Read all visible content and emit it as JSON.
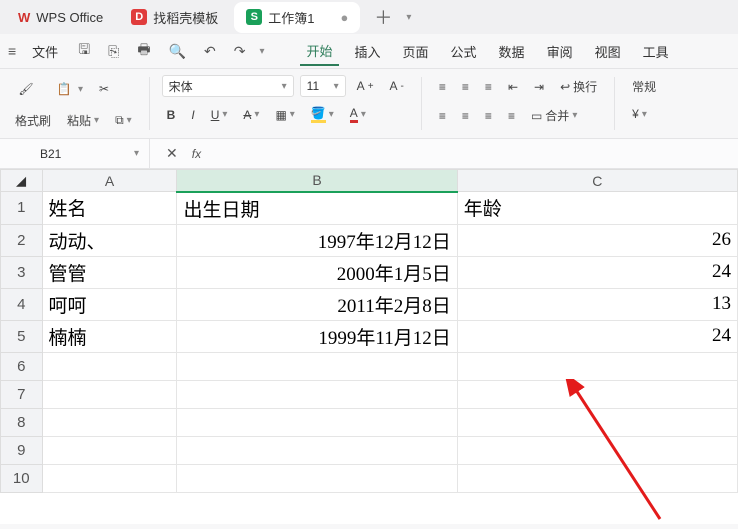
{
  "top_tabs": {
    "office": "WPS Office",
    "templates": "找稻壳模板",
    "workbook": "工作簿1"
  },
  "menubar": {
    "file": "文件",
    "items": [
      "开始",
      "插入",
      "页面",
      "公式",
      "数据",
      "审阅",
      "视图",
      "工具"
    ],
    "active": "开始"
  },
  "ribbon": {
    "format_painter": "格式刷",
    "paste": "粘贴",
    "font": "宋体",
    "font_size": "11",
    "bold": "B",
    "italic": "I",
    "underline": "U",
    "strike": "A",
    "wrap": "换行",
    "merge": "合并",
    "normal": "常规",
    "currency": "¥"
  },
  "namebox": "B21",
  "fx_label": "fx",
  "columns": {
    "A": "A",
    "B": "B",
    "C": "C"
  },
  "row_nums": [
    "1",
    "2",
    "3",
    "4",
    "5",
    "6",
    "7",
    "8",
    "9",
    "10"
  ],
  "cells": {
    "header_name": "姓名",
    "header_birth": "出生日期",
    "header_age": "年龄",
    "r2a": "动动、",
    "r2b": "1997年12月12日",
    "r2c": "26",
    "r3a": "管管",
    "r3b": "2000年1月5日",
    "r3c": "24",
    "r4a": "呵呵",
    "r4b": "2011年2月8日",
    "r4c": "13",
    "r5a": "楠楠",
    "r5b": "1999年11月12日",
    "r5c": "24"
  }
}
